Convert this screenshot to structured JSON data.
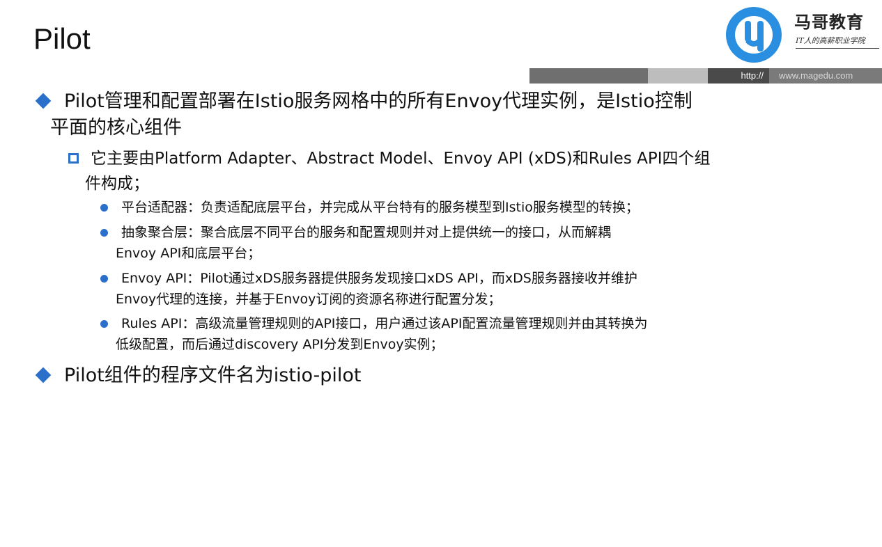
{
  "slide": {
    "title": "Pilot"
  },
  "logo": {
    "brand": "马哥教育",
    "slogan": "IT人的高薪职业学院",
    "icon": "magedu-logo-icon",
    "color": "#2a8fe0"
  },
  "url_bar": {
    "prefix": "http://",
    "url": "www.magedu.com"
  },
  "content": {
    "bullets": [
      {
        "text_line1": "Pilot管理和配置部署在Istio服务网格中的所有Envoy代理实例，是Istio控制",
        "text_line2": "平面的核心组件",
        "sub": {
          "text_line1": "它主要由Platform Adapter、Abstract Model、Envoy API (xDS)和Rules API四个组",
          "text_line2": "件构成；",
          "items": [
            {
              "line1": "平台适配器：负责适配底层平台，并完成从平台特有的服务模型到Istio服务模型的转换；"
            },
            {
              "line1": "抽象聚合层：聚合底层不同平台的服务和配置规则并对上提供统一的接口，从而解耦",
              "line2": "Envoy API和底层平台；"
            },
            {
              "line1": "Envoy API：Pilot通过xDS服务器提供服务发现接口xDS API，而xDS服务器接收并维护",
              "line2": "Envoy代理的连接，并基于Envoy订阅的资源名称进行配置分发；"
            },
            {
              "line1": "Rules API：高级流量管理规则的API接口，用户通过该API配置流量管理规则并由其转换为",
              "line2": "低级配置，而后通过discovery API分发到Envoy实例；"
            }
          ]
        }
      },
      {
        "text_line1": "Pilot组件的程序文件名为istio-pilot"
      }
    ]
  },
  "colors": {
    "bullet": "#2a6fc9",
    "text": "#111111"
  }
}
